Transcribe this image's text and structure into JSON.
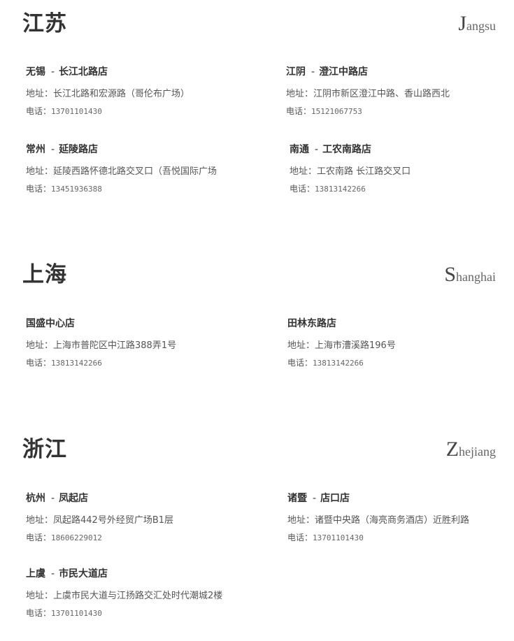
{
  "regions": [
    {
      "title": "江苏",
      "en_initial": "J",
      "en_rest": "angsu",
      "stores": [
        {
          "city": "无锡",
          "dash": "-",
          "branch": "长江北路店",
          "address": "地址：长江北路和宏源路（哥伦布广场）",
          "phone_label": "电话：",
          "phone": "13701101430"
        },
        {
          "city": "江阴",
          "dash": "-",
          "branch": "澄江中路店",
          "address": "地址：江阴市新区澄江中路、香山路西北",
          "phone_label": "电话：",
          "phone": "15121067753"
        },
        {
          "city": "常州",
          "dash": "-",
          "branch": "延陵路店",
          "address": "地址：延陵西路怀德北路交叉口（吾悦国际广场",
          "phone_label": "电话：",
          "phone": "13451936388"
        },
        {
          "city": "南通",
          "dash": "-",
          "branch": "工农南路店",
          "address": "地址：工农南路 长江路交叉口",
          "phone_label": "电话：",
          "phone": "13813142266"
        }
      ]
    },
    {
      "title": "上海",
      "en_initial": "S",
      "en_rest": "hanghai",
      "stores": [
        {
          "city": "国盛中心店",
          "dash": "",
          "branch": "",
          "address": "地址：上海市普陀区中江路388弄1号",
          "phone_label": "电话：",
          "phone": "13813142266"
        },
        {
          "city": "田林东路店",
          "dash": "",
          "branch": "",
          "address": "地址：上海市漕溪路196号",
          "phone_label": "电话：",
          "phone": "13813142266"
        }
      ]
    },
    {
      "title": "浙江",
      "en_initial": "Z",
      "en_rest": "hejiang",
      "stores": [
        {
          "city": "杭州",
          "dash": "-",
          "branch": "凤起店",
          "address": "地址：凤起路442号外经贸广场B1层",
          "phone_label": "电话：",
          "phone": "18606229012"
        },
        {
          "city": "诸暨",
          "dash": "-",
          "branch": "店口店",
          "address": "地址：诸暨中央路（海亮商务酒店）近胜利路",
          "phone_label": "电话：",
          "phone": "13701101430"
        },
        {
          "city": "上虞",
          "dash": "-",
          "branch": "市民大道店",
          "address": "地址：上虞市民大道与江扬路交汇处时代潮城2楼",
          "phone_label": "电话：",
          "phone": "13701101430"
        }
      ]
    }
  ]
}
